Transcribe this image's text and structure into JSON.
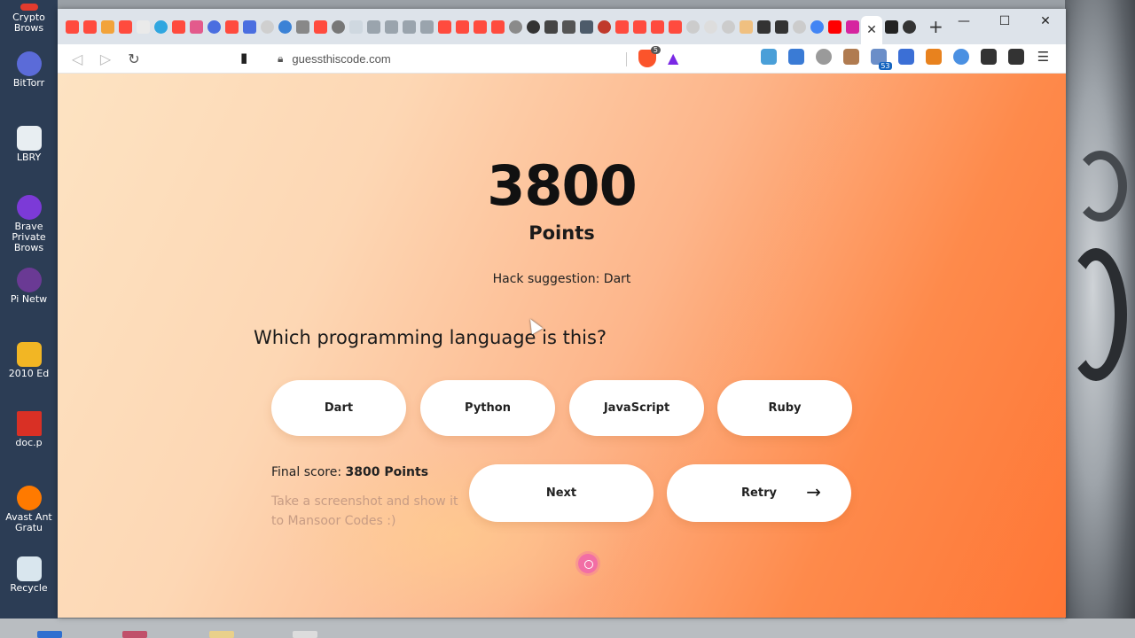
{
  "browser": {
    "url": "guessthiscode.com",
    "active_tab_glyph": "✕",
    "new_tab_glyph": "+",
    "shields_count": "5",
    "extension_badge": "53",
    "window_controls": [
      "—",
      "☐",
      "✕"
    ]
  },
  "desktop": {
    "icons": [
      "Crypto Brows",
      "BitTorr",
      "LBRY",
      "Brave Private Brows",
      "Pi Netw",
      "2010 Ed",
      "doc.p",
      "Avast Ant Gratu",
      "Recycle"
    ]
  },
  "quiz": {
    "score": "3800",
    "points_label": "Points",
    "hack_suggestion": "Hack suggestion: Dart",
    "question": "Which programming language is this?",
    "answers": [
      "Dart",
      "Python",
      "JavaScript",
      "Ruby"
    ],
    "final_score_label": "Final score: ",
    "final_score_value": "3800 Points",
    "hint": "Take a screenshot and show it to Mansoor Codes :)",
    "next_label": "Next",
    "retry_label": "Retry",
    "retry_icon": "→"
  },
  "colors": {
    "gradient_start": "#fde3c2",
    "gradient_end": "#ff7635",
    "button_bg": "#ffffff"
  }
}
